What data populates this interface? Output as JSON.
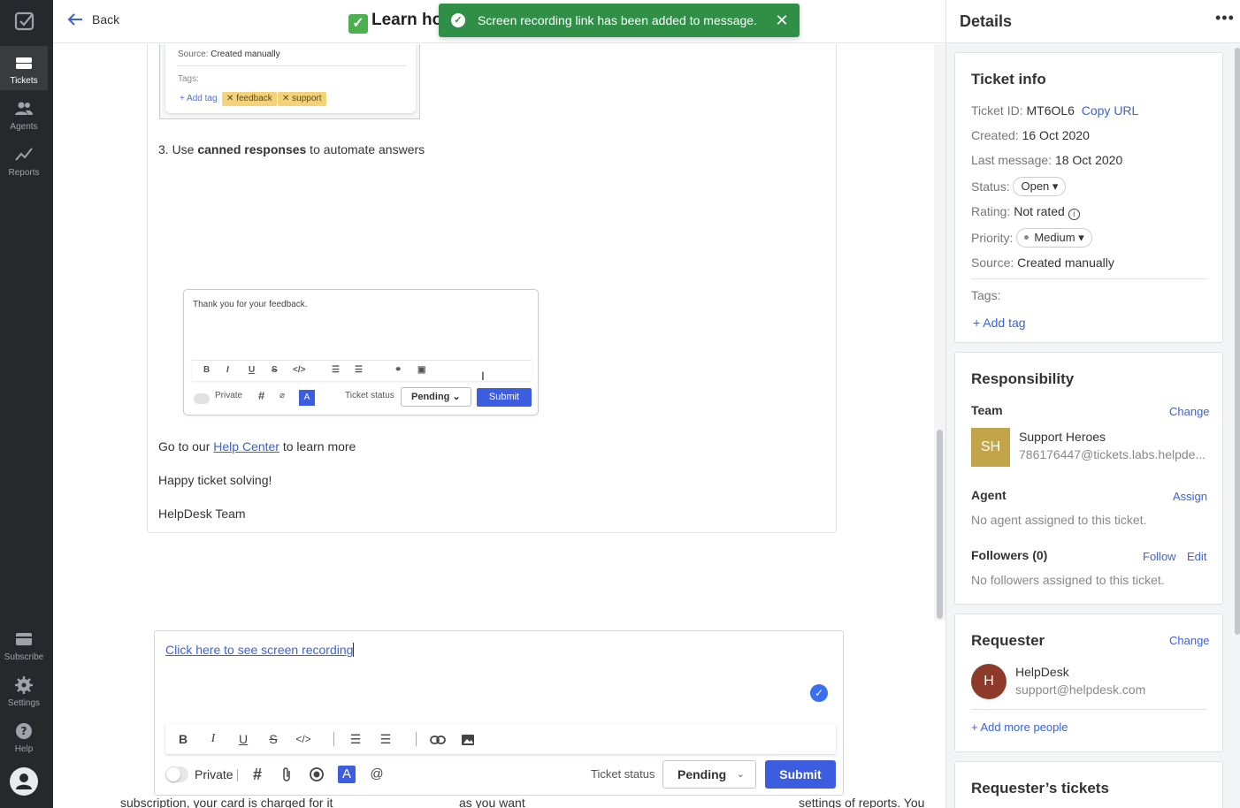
{
  "nav": {
    "items": [
      {
        "label": "Tickets"
      },
      {
        "label": "Agents"
      },
      {
        "label": "Reports"
      },
      {
        "label": "Subscribe"
      },
      {
        "label": "Settings"
      },
      {
        "label": "Help"
      }
    ]
  },
  "header": {
    "back_label": "Back",
    "title": "Learn ho"
  },
  "toast": {
    "message": "Screen recording link has been added to message."
  },
  "message": {
    "image1": {
      "source_label": "Source:",
      "source_value": "Created manually",
      "tags_label": "Tags:",
      "add_tag": "+ Add tag",
      "chips": [
        "feedback",
        "support"
      ]
    },
    "step3_prefix": "3. Use ",
    "step3_bold": "canned responses",
    "step3_suffix": " to automate answers",
    "image2": {
      "text": "Thank you for your feedback.",
      "private": "Private",
      "ticket_status": "Ticket status",
      "status": "Pending",
      "submit": "Submit"
    },
    "help_prefix": "Go to our ",
    "help_link": "Help Center",
    "help_suffix": " to learn more",
    "closing": "Happy ticket solving!",
    "signature": "HelpDesk Team"
  },
  "composer": {
    "link_text": "Click here to see screen recording",
    "private_label": "Private",
    "ticket_status_label": "Ticket status",
    "status_value": "Pending",
    "submit_label": "Submit"
  },
  "cutoff_text": {
    "a": "subscription, your card is charged for it",
    "b": "as you want",
    "c": "settings of reports. You can add as many"
  },
  "details": {
    "title": "Details",
    "ticket_info": {
      "heading": "Ticket info",
      "ticket_id_label": "Ticket ID:",
      "ticket_id": "MT6OL6",
      "copy_url": "Copy URL",
      "created_label": "Created:",
      "created": "16 Oct 2020",
      "last_message_label": "Last message:",
      "last_message": "18 Oct 2020",
      "status_label": "Status:",
      "status": "Open",
      "rating_label": "Rating:",
      "rating": "Not rated",
      "priority_label": "Priority:",
      "priority": "Medium",
      "source_label": "Source:",
      "source": "Created manually",
      "tags_label": "Tags:",
      "add_tag": "+ Add tag"
    },
    "responsibility": {
      "heading": "Responsibility",
      "team_label": "Team",
      "change": "Change",
      "team_initials": "SH",
      "team_name": "Support Heroes",
      "team_email": "786176447@tickets.labs.helpde...",
      "agent_label": "Agent",
      "assign": "Assign",
      "agent_empty": "No agent assigned to this ticket.",
      "followers_label": "Followers (0)",
      "follow": "Follow",
      "edit": "Edit",
      "followers_empty": "No followers assigned to this ticket."
    },
    "requester": {
      "heading": "Requester",
      "change": "Change",
      "initial": "H",
      "name": "HelpDesk",
      "email": "support@helpdesk.com",
      "add_more": "+ Add more people"
    },
    "requester_tickets": {
      "heading": "Requester’s tickets"
    }
  },
  "colors": {
    "accent": "#3c5de0",
    "toast_green": "#2f8f46",
    "nav_bg": "#27282b",
    "team_avatar": "#c2a54a",
    "requester_avatar": "#8e3a2b"
  }
}
